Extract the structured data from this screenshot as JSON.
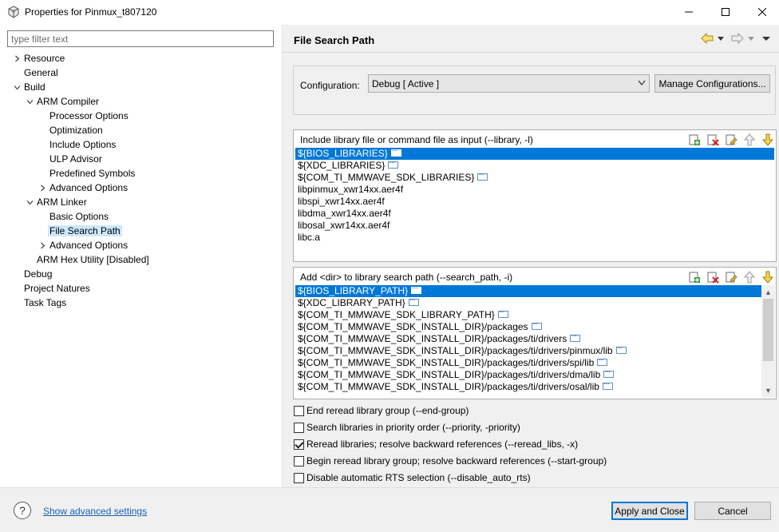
{
  "window": {
    "title": "Properties for Pinmux_t807120",
    "icon": "gear-cube-icon"
  },
  "filter": {
    "placeholder": "type filter text",
    "value": ""
  },
  "tree": [
    {
      "label": "Resource",
      "expandable": true,
      "expanded": false
    },
    {
      "label": "General"
    },
    {
      "label": "Build",
      "expandable": true,
      "expanded": true
    },
    {
      "label": "ARM Compiler",
      "expandable": true,
      "expanded": true
    },
    {
      "label": "Processor Options"
    },
    {
      "label": "Optimization"
    },
    {
      "label": "Include Options"
    },
    {
      "label": "ULP Advisor"
    },
    {
      "label": "Predefined Symbols"
    },
    {
      "label": "Advanced Options",
      "expandable": true,
      "expanded": false
    },
    {
      "label": "ARM Linker",
      "expandable": true,
      "expanded": true
    },
    {
      "label": "Basic Options"
    },
    {
      "label": "File Search Path",
      "selected": true
    },
    {
      "label": "Advanced Options",
      "expandable": true,
      "expanded": false
    },
    {
      "label": "ARM Hex Utility  [Disabled]"
    },
    {
      "label": "Debug"
    },
    {
      "label": "Project Natures"
    },
    {
      "label": "Task Tags"
    }
  ],
  "page": {
    "title": "File Search Path"
  },
  "configuration": {
    "label": "Configuration:",
    "value": "Debug  [ Active ]",
    "manage_label": "Manage Configurations..."
  },
  "library_group": {
    "title": "Include library file or command file as input (--library, -l)",
    "items": [
      {
        "text": "${BIOS_LIBRARIES}",
        "variable": true,
        "selected": true
      },
      {
        "text": "${XDC_LIBRARIES}",
        "variable": true
      },
      {
        "text": "${COM_TI_MMWAVE_SDK_LIBRARIES}",
        "variable": true
      },
      {
        "text": "libpinmux_xwr14xx.aer4f"
      },
      {
        "text": "libspi_xwr14xx.aer4f"
      },
      {
        "text": "libdma_xwr14xx.aer4f"
      },
      {
        "text": "libosal_xwr14xx.aer4f"
      },
      {
        "text": "libc.a"
      }
    ]
  },
  "search_group": {
    "title": "Add <dir> to library search path (--search_path, -i)",
    "items": [
      {
        "text": "${BIOS_LIBRARY_PATH}",
        "variable": true,
        "selected": true
      },
      {
        "text": "${XDC_LIBRARY_PATH}",
        "variable": true
      },
      {
        "text": "${COM_TI_MMWAVE_SDK_LIBRARY_PATH}",
        "variable": true
      },
      {
        "text": "${COM_TI_MMWAVE_SDK_INSTALL_DIR}/packages",
        "variable": true
      },
      {
        "text": "${COM_TI_MMWAVE_SDK_INSTALL_DIR}/packages/ti/drivers",
        "variable": true
      },
      {
        "text": "${COM_TI_MMWAVE_SDK_INSTALL_DIR}/packages/ti/drivers/pinmux/lib",
        "variable": true
      },
      {
        "text": "${COM_TI_MMWAVE_SDK_INSTALL_DIR}/packages/ti/drivers/spi/lib",
        "variable": true
      },
      {
        "text": "${COM_TI_MMWAVE_SDK_INSTALL_DIR}/packages/ti/drivers/dma/lib",
        "variable": true
      },
      {
        "text": "${COM_TI_MMWAVE_SDK_INSTALL_DIR}/packages/ti/drivers/osal/lib",
        "variable": true
      }
    ]
  },
  "options": [
    {
      "label": "End reread library group (--end-group)",
      "checked": false
    },
    {
      "label": "Search libraries in priority order (--priority, -priority)",
      "checked": false
    },
    {
      "label": "Reread libraries; resolve backward references (--reread_libs, -x)",
      "checked": true
    },
    {
      "label": "Begin reread library group; resolve backward references (--start-group)",
      "checked": false
    },
    {
      "label": "Disable automatic RTS selection (--disable_auto_rts)",
      "checked": false
    }
  ],
  "bottom": {
    "help_glyph": "?",
    "advanced_link": "Show advanced settings",
    "apply_label": "Apply and Close",
    "cancel_label": "Cancel"
  },
  "colors": {
    "selection": "#0078d7",
    "tree_selection": "#cce8ff",
    "link": "#1a5fb4"
  }
}
